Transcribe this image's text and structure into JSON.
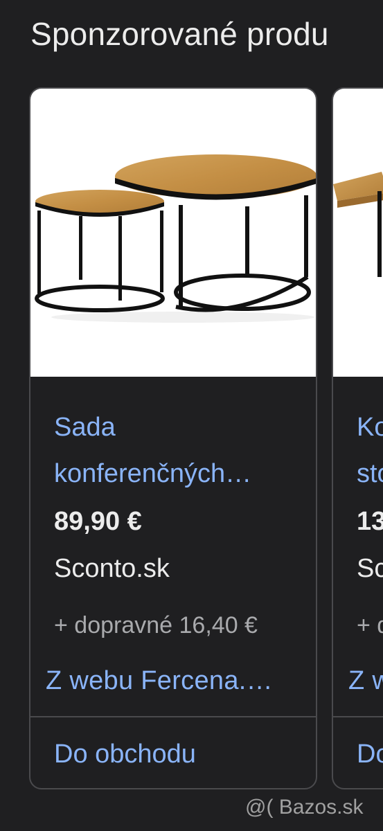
{
  "section": {
    "title": "Sponzorované produ"
  },
  "cards": [
    {
      "title_line1": "Sada",
      "title_line2": "konferenčných…",
      "price": "89,90 €",
      "merchant": "Sconto.sk",
      "shipping": "+ dopravné 16,40 €",
      "from_web": "Z webu Fercena.…",
      "cta": "Do obchodu",
      "image_icon": "round-nesting-coffee-tables-image"
    },
    {
      "title_line1": "Ko",
      "title_line2": "sto",
      "price": "13",
      "merchant": "Sc",
      "shipping": "+ d",
      "from_web": "Z w",
      "cta": "Do",
      "image_icon": "rectangular-coffee-table-image"
    }
  ],
  "watermark": "@( Bazos.sk",
  "colors": {
    "background": "#1f1f21",
    "card_border": "#4a4a4d",
    "link_blue": "#8ab4f8",
    "text_primary": "#ececec",
    "text_secondary": "#a9aaad"
  }
}
